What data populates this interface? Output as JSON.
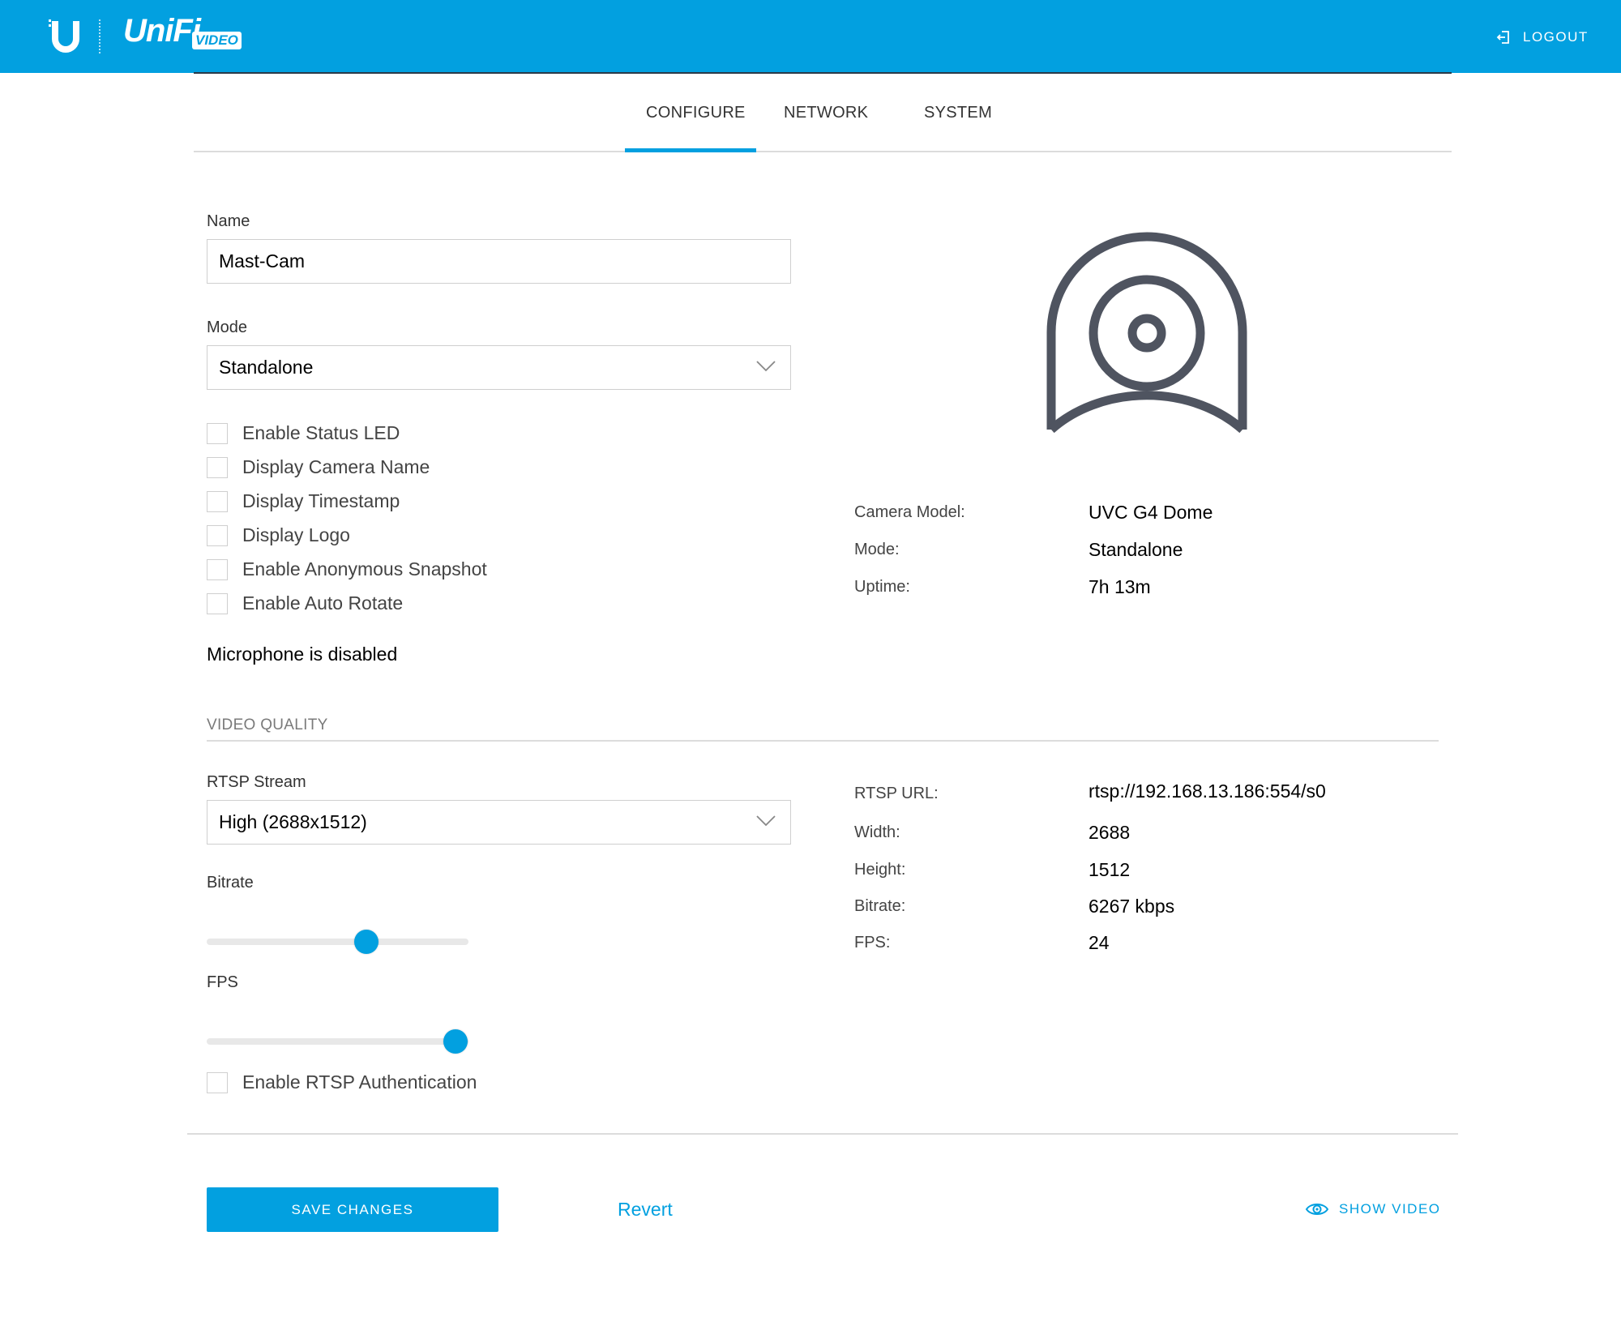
{
  "header": {
    "brand": "UniFi",
    "brand_badge": "VIDEO",
    "logout_label": "LOGOUT",
    "accent_color": "#02a0e0"
  },
  "tabs": [
    {
      "label": "CONFIGURE",
      "active": true
    },
    {
      "label": "NETWORK",
      "active": false
    },
    {
      "label": "SYSTEM",
      "active": false
    }
  ],
  "form": {
    "name_label": "Name",
    "name_value": "Mast-Cam",
    "mode_label": "Mode",
    "mode_value": "Standalone",
    "checkboxes": [
      {
        "label": "Enable Status LED",
        "checked": false
      },
      {
        "label": "Display Camera Name",
        "checked": false
      },
      {
        "label": "Display Timestamp",
        "checked": false
      },
      {
        "label": "Display Logo",
        "checked": false
      },
      {
        "label": "Enable Anonymous Snapshot",
        "checked": false
      },
      {
        "label": "Enable Auto Rotate",
        "checked": false
      }
    ],
    "microphone_status": "Microphone is disabled"
  },
  "camera_info": {
    "icon": "camera-dome-icon",
    "rows": [
      {
        "label": "Camera Model:",
        "value": "UVC G4 Dome"
      },
      {
        "label": "Mode:",
        "value": "Standalone"
      },
      {
        "label": "Uptime:",
        "value": "7h 13m"
      }
    ]
  },
  "video_quality": {
    "section_title": "VIDEO QUALITY",
    "rtsp_stream_label": "RTSP Stream",
    "rtsp_stream_value": "High (2688x1512)",
    "bitrate_label": "Bitrate",
    "bitrate_slider_fraction": 0.61,
    "fps_label": "FPS",
    "fps_slider_fraction": 0.95,
    "rtsp_auth_label": "Enable RTSP Authentication",
    "rtsp_auth_checked": false,
    "info_rows": [
      {
        "label": "RTSP URL:",
        "value": "rtsp://192.168.13.186:554/s0"
      },
      {
        "label": "Width:",
        "value": "2688"
      },
      {
        "label": "Height:",
        "value": "1512"
      },
      {
        "label": "Bitrate:",
        "value": "6267 kbps"
      },
      {
        "label": "FPS:",
        "value": "24"
      }
    ]
  },
  "actions": {
    "save_label": "SAVE CHANGES",
    "revert_label": "Revert",
    "show_video_label": "SHOW VIDEO"
  }
}
